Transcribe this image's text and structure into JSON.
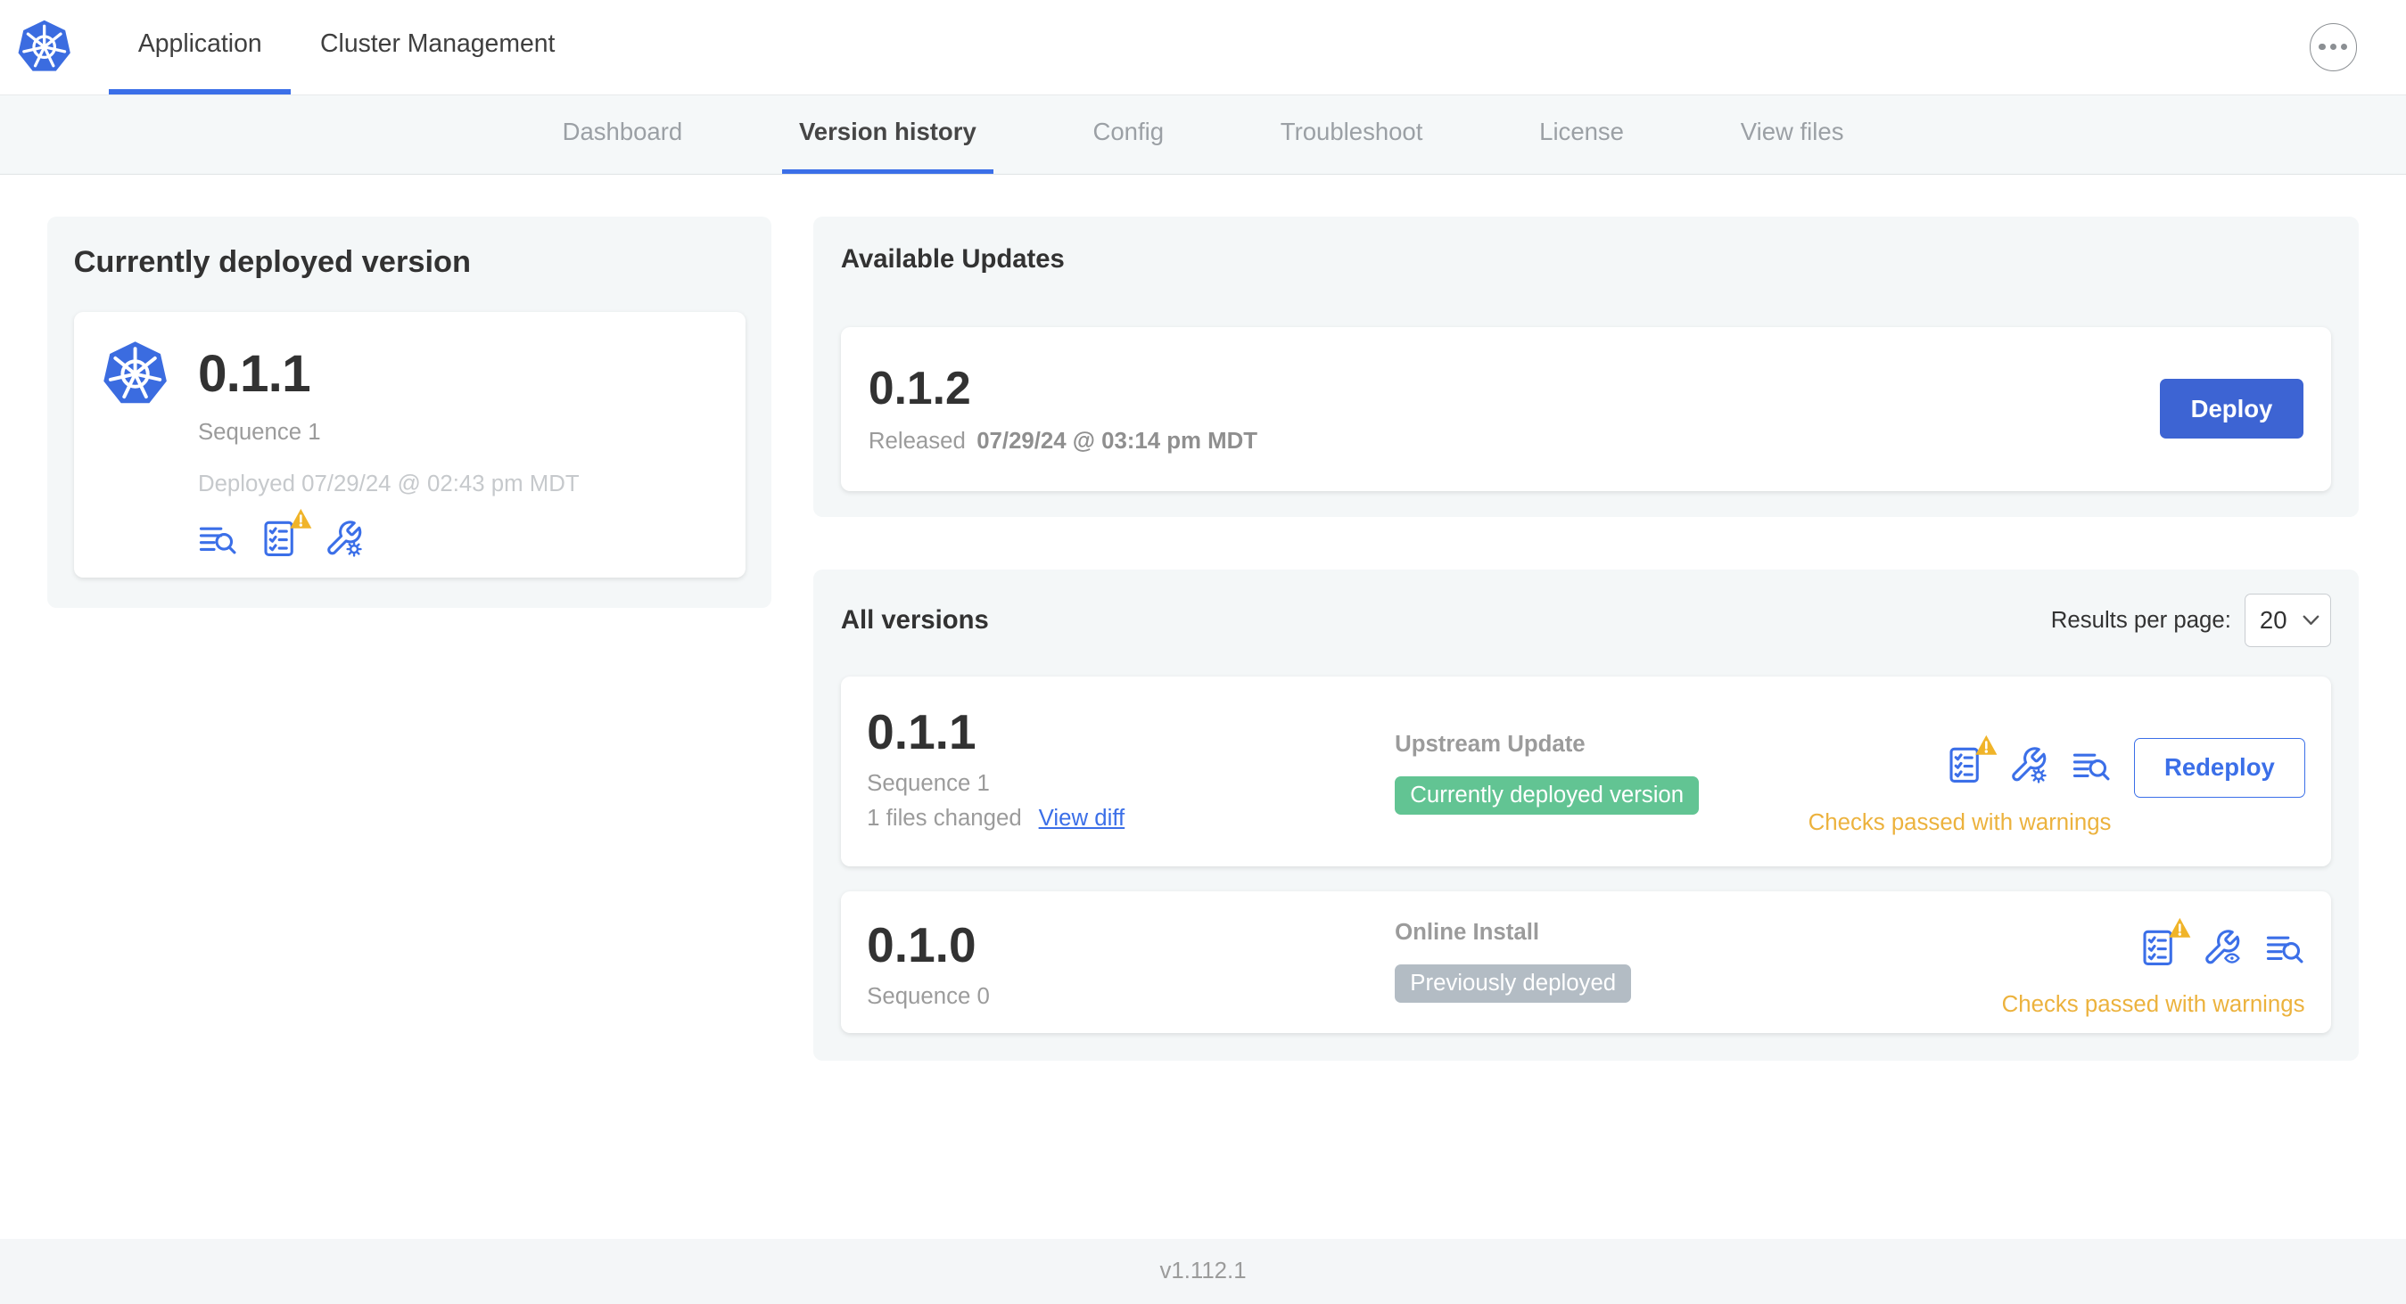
{
  "colors": {
    "accent-blue": "#3b6fe8",
    "button-blue": "#3d64d3",
    "green-badge": "#62c493",
    "gray-badge": "#b3bcc4",
    "warning-text": "#ecb23d",
    "warning-triangle": "#f0b429",
    "k8s-blue": "#3b6ce0"
  },
  "header": {
    "logo_icon": "kubernetes-logo",
    "tabs": [
      {
        "label": "Application",
        "active": true
      },
      {
        "label": "Cluster Management",
        "active": false
      }
    ],
    "overflow_icon": "ellipsis-menu"
  },
  "subnav": {
    "tabs": [
      {
        "label": "Dashboard",
        "active": false
      },
      {
        "label": "Version history",
        "active": true
      },
      {
        "label": "Config",
        "active": false
      },
      {
        "label": "Troubleshoot",
        "active": false
      },
      {
        "label": "License",
        "active": false
      },
      {
        "label": "View files",
        "active": false
      }
    ]
  },
  "deployed_card": {
    "title": "Currently deployed version",
    "version": "0.1.1",
    "sequence": "Sequence 1",
    "deployed_at": "Deployed 07/29/24 @ 02:43 pm MDT",
    "icons": [
      "view-files-icon",
      "preflight-checks-warning-icon",
      "edit-config-icon"
    ]
  },
  "available_updates": {
    "title": "Available Updates",
    "version": "0.1.2",
    "released_prefix": "Released",
    "released_at": "07/29/24 @ 03:14 pm MDT",
    "deploy_label": "Deploy"
  },
  "all_versions": {
    "title": "All versions",
    "results_per_page_label": "Results per page:",
    "results_per_page_value": "20",
    "rows": [
      {
        "version": "0.1.1",
        "sequence": "Sequence 1",
        "files_changed": "1 files changed",
        "view_diff_label": "View diff",
        "source": "Upstream Update",
        "badge": "Currently deployed version",
        "badge_color": "green",
        "icons": [
          "preflight-checks-warning-icon",
          "edit-config-icon",
          "view-files-icon"
        ],
        "action_label": "Redeploy",
        "status": "Checks passed with warnings"
      },
      {
        "version": "0.1.0",
        "sequence": "Sequence 0",
        "source": "Online Install",
        "badge": "Previously deployed",
        "badge_color": "gray",
        "icons": [
          "preflight-checks-warning-icon",
          "view-config-icon",
          "view-files-icon"
        ],
        "status": "Checks passed with warnings"
      }
    ]
  },
  "footer": {
    "app_version": "v1.112.1"
  }
}
